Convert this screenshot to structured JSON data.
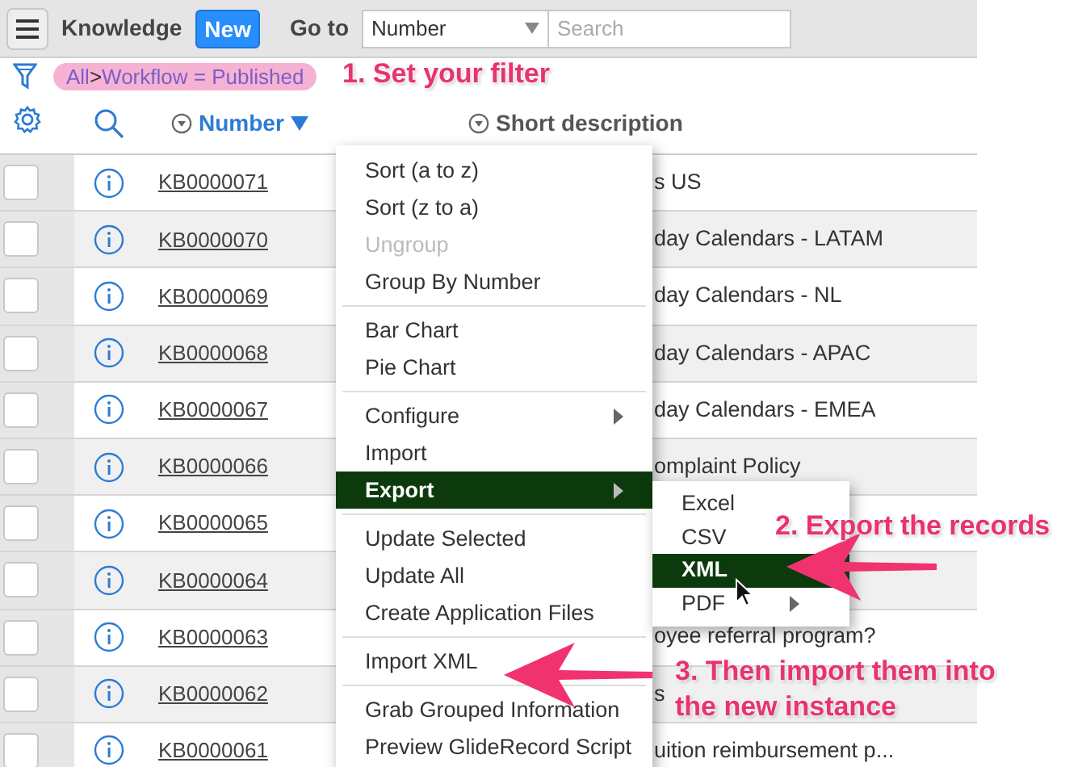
{
  "header": {
    "title": "Knowledge",
    "new_button": "New",
    "goto_label": "Go to",
    "goto_field": "Number",
    "search": {
      "placeholder": "Search"
    }
  },
  "filter": [
    {
      "kind": "link",
      "text": "All"
    },
    {
      "kind": "separator",
      "text": ">"
    },
    {
      "kind": "link",
      "text": "Workflow = Published"
    }
  ],
  "columns": [
    {
      "label": "Number",
      "sorted": true
    },
    {
      "label": "Short description",
      "sorted": false
    }
  ],
  "rows": [
    {
      "number": "KB0000071",
      "description": "s US",
      "checked": false
    },
    {
      "number": "KB0000070",
      "description": "day Calendars - LATAM",
      "checked": false
    },
    {
      "number": "KB0000069",
      "description": "day Calendars - NL",
      "checked": false
    },
    {
      "number": "KB0000068",
      "description": "day Calendars - APAC",
      "checked": false
    },
    {
      "number": "KB0000067",
      "description": "day Calendars - EMEA",
      "checked": false
    },
    {
      "number": "KB0000066",
      "description": "omplaint Policy",
      "checked": false
    },
    {
      "number": "KB0000065",
      "checked": false
    },
    {
      "number": "KB0000064",
      "checked": false
    },
    {
      "number": "KB0000063",
      "description": "oyee referral program?",
      "checked": false
    },
    {
      "number": "KB0000062",
      "description": "s",
      "checked": false
    },
    {
      "number": "KB0000061",
      "description": "uition reimbursement p...",
      "checked": false
    }
  ],
  "context_menu": {
    "groups": [
      [
        {
          "label": "Sort (a to z)",
          "disabled": false,
          "selected": false,
          "submenu": false
        },
        {
          "label": "Sort (z to a)",
          "disabled": false,
          "selected": false,
          "submenu": false
        },
        {
          "label": "Ungroup",
          "disabled": true,
          "selected": false,
          "submenu": false
        },
        {
          "label": "Group By Number",
          "disabled": false,
          "selected": false,
          "submenu": false
        }
      ],
      [
        {
          "label": "Bar Chart",
          "disabled": false,
          "selected": false,
          "submenu": false
        },
        {
          "label": "Pie Chart",
          "disabled": false,
          "selected": false,
          "submenu": false
        }
      ],
      [
        {
          "label": "Configure",
          "disabled": false,
          "selected": false,
          "submenu": true
        },
        {
          "label": "Import",
          "disabled": false,
          "selected": false,
          "submenu": false
        },
        {
          "label": "Export",
          "disabled": false,
          "selected": true,
          "submenu": true
        }
      ],
      [
        {
          "label": "Update Selected",
          "disabled": false,
          "selected": false,
          "submenu": false
        },
        {
          "label": "Update All",
          "disabled": false,
          "selected": false,
          "submenu": false
        },
        {
          "label": "Create Application Files",
          "disabled": false,
          "selected": false,
          "submenu": false
        }
      ],
      [
        {
          "label": "Import XML",
          "disabled": false,
          "selected": false,
          "submenu": false
        }
      ],
      [
        {
          "label": "Grab Grouped Information",
          "disabled": false,
          "selected": false,
          "submenu": false
        },
        {
          "label": "Preview GlideRecord Script",
          "disabled": false,
          "selected": false,
          "submenu": false
        }
      ]
    ]
  },
  "submenu": [
    {
      "label": "Excel",
      "selected": false,
      "submenu": false
    },
    {
      "label": "CSV",
      "selected": false,
      "submenu": false
    },
    {
      "label": "XML",
      "selected": true,
      "submenu": false
    },
    {
      "label": "PDF",
      "selected": false,
      "submenu": true
    }
  ],
  "annotations": [
    {
      "text": "1. Set your filter"
    },
    {
      "text": "2. Export the records"
    },
    {
      "text": "3. Then import them into the new instance"
    }
  ]
}
